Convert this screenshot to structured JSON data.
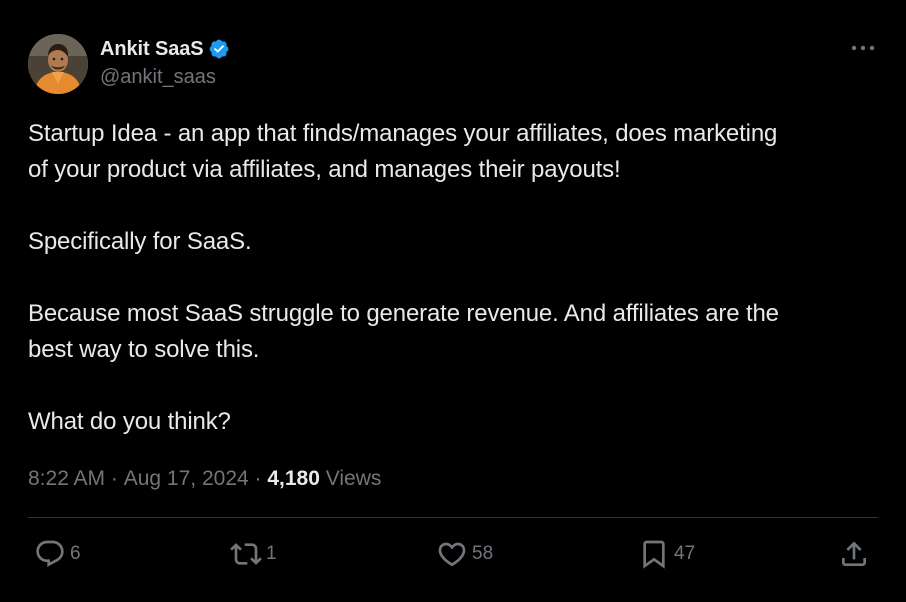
{
  "author": {
    "display_name": "Ankit SaaS",
    "handle": "@ankit_saas",
    "verified_icon": "verified-badge-icon",
    "verified_color": "#1d9bf0"
  },
  "tweet": {
    "text": "Startup Idea - an app that finds/manages your affiliates, does marketing\nof your product via affiliates, and manages their payouts!\n\nSpecifically for SaaS.\n\nBecause most SaaS struggle to generate revenue. And affiliates are the\nbest way to solve this.\n\nWhat do you think?",
    "time": "8:22 AM",
    "separator": " · ",
    "date": "Aug 17, 2024",
    "views_count": "4,180",
    "views_label": "Views"
  },
  "actions": {
    "reply_count": "6",
    "retweet_count": "1",
    "like_count": "58",
    "bookmark_count": "47"
  },
  "icons": {
    "more": "more-horizontal-icon",
    "reply": "reply-icon",
    "retweet": "retweet-icon",
    "like": "heart-icon",
    "bookmark": "bookmark-icon",
    "share": "share-icon"
  },
  "colors": {
    "background": "#000000",
    "text_primary": "#e7e9ea",
    "text_secondary": "#71767b",
    "divider": "#2f3336",
    "accent": "#1d9bf0"
  }
}
